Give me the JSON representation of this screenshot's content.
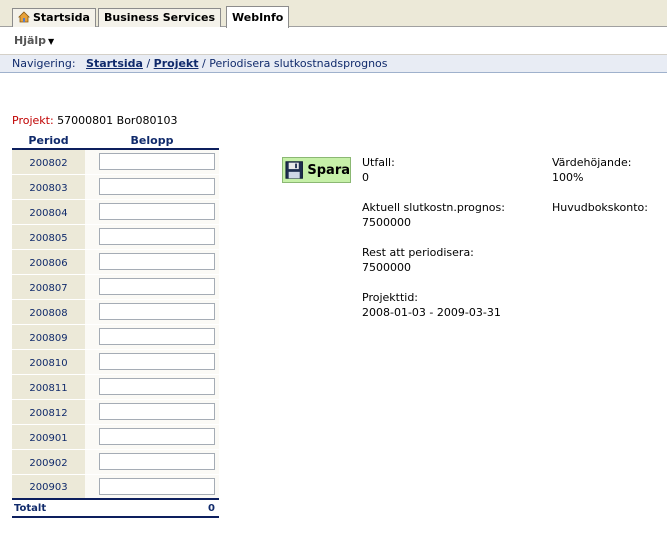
{
  "tabs": [
    {
      "label": "Startsida",
      "active": false
    },
    {
      "label": "Business Services",
      "active": false
    },
    {
      "label": "WebInfo",
      "active": true
    }
  ],
  "menu": {
    "help": "Hjälp"
  },
  "nav": {
    "prefix": "Navigering:",
    "crumbs": [
      "Startsida",
      "Projekt"
    ],
    "separator": "/",
    "current": "Periodisera slutkostnadsprognos"
  },
  "project": {
    "label": "Projekt:",
    "value": "57000801 Bor080103"
  },
  "table": {
    "headers": [
      "Period",
      "Belopp"
    ],
    "periods": [
      "200802",
      "200803",
      "200804",
      "200805",
      "200806",
      "200807",
      "200808",
      "200809",
      "200810",
      "200811",
      "200812",
      "200901",
      "200902",
      "200903"
    ],
    "total_label": "Totalt",
    "total_value": "0"
  },
  "save": {
    "label": "Spara",
    "icon": "floppy-disk-icon"
  },
  "info": {
    "utfall": {
      "label": "Utfall:",
      "value": "0"
    },
    "prognos": {
      "label": "Aktuell slutkostn.prognos:",
      "value": "7500000"
    },
    "rest": {
      "label": "Rest att periodisera:",
      "value": "7500000"
    },
    "projekttid": {
      "label": "Projekttid:",
      "value": "2008-01-03 - 2009-03-31"
    },
    "vardehojande": {
      "label": "Värdehöjande:",
      "value": "100%"
    },
    "huvudbok": {
      "label": "Huvudbokskonto:",
      "value": ""
    }
  },
  "colors": {
    "nav_text": "#102a6b",
    "project_label": "#c00000",
    "save_bg": "#c6f0a8"
  }
}
